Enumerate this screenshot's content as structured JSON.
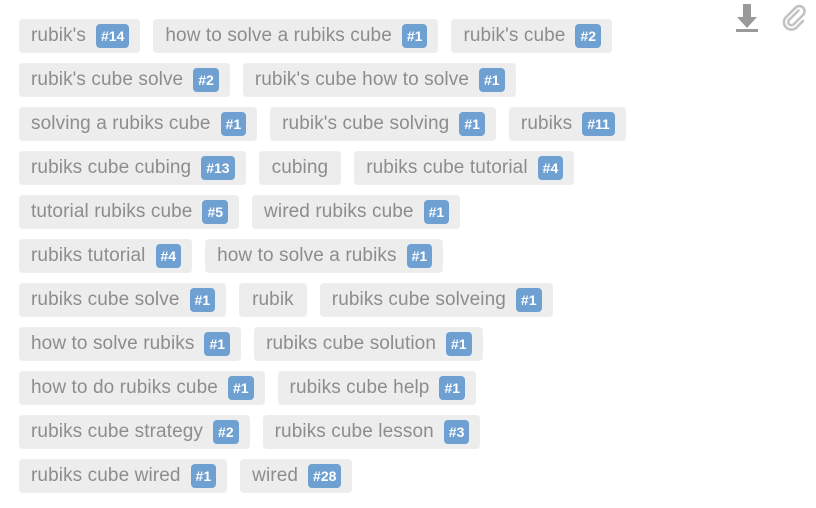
{
  "panel": {
    "name": "tag-cloud-panel",
    "chip_bg": "#ededed",
    "chip_text_color": "#8d8d8d",
    "badge_bg": "#6fa0d2",
    "badge_text_color": "#ffffff"
  },
  "overlay": {
    "download_icon": "download-icon",
    "paperclip_icon": "paperclip-icon"
  },
  "rows": [
    [
      {
        "label": "rubik's",
        "badge": "#14"
      },
      {
        "label": "how to solve a rubiks cube",
        "badge": "#1"
      },
      {
        "label": "rubik's cube",
        "badge": "#2"
      }
    ],
    [
      {
        "label": "rubik's cube solve",
        "badge": "#2"
      },
      {
        "label": "rubik's cube how to solve",
        "badge": "#1"
      }
    ],
    [
      {
        "label": "solving a rubiks cube",
        "badge": "#1"
      },
      {
        "label": "rubik's cube solving",
        "badge": "#1"
      },
      {
        "label": "rubiks",
        "badge": "#11"
      }
    ],
    [
      {
        "label": "rubiks cube cubing",
        "badge": "#13"
      },
      {
        "label": "cubing",
        "badge": ""
      },
      {
        "label": "rubiks cube tutorial",
        "badge": "#4"
      }
    ],
    [
      {
        "label": "tutorial rubiks cube",
        "badge": "#5"
      },
      {
        "label": "wired rubiks cube",
        "badge": "#1"
      }
    ],
    [
      {
        "label": "rubiks tutorial",
        "badge": "#4"
      },
      {
        "label": "how to solve a rubiks",
        "badge": "#1"
      }
    ],
    [
      {
        "label": "rubiks cube solve",
        "badge": "#1"
      },
      {
        "label": "rubik",
        "badge": ""
      },
      {
        "label": "rubiks cube solveing",
        "badge": "#1"
      }
    ],
    [
      {
        "label": "how to solve rubiks",
        "badge": "#1"
      },
      {
        "label": "rubiks cube solution",
        "badge": "#1"
      }
    ],
    [
      {
        "label": "how to do rubiks cube",
        "badge": "#1"
      },
      {
        "label": "rubiks cube help",
        "badge": "#1"
      }
    ],
    [
      {
        "label": "rubiks cube strategy",
        "badge": "#2"
      },
      {
        "label": "rubiks cube lesson",
        "badge": "#3"
      }
    ],
    [
      {
        "label": "rubiks cube wired",
        "badge": "#1"
      },
      {
        "label": "wired",
        "badge": "#28"
      }
    ]
  ]
}
